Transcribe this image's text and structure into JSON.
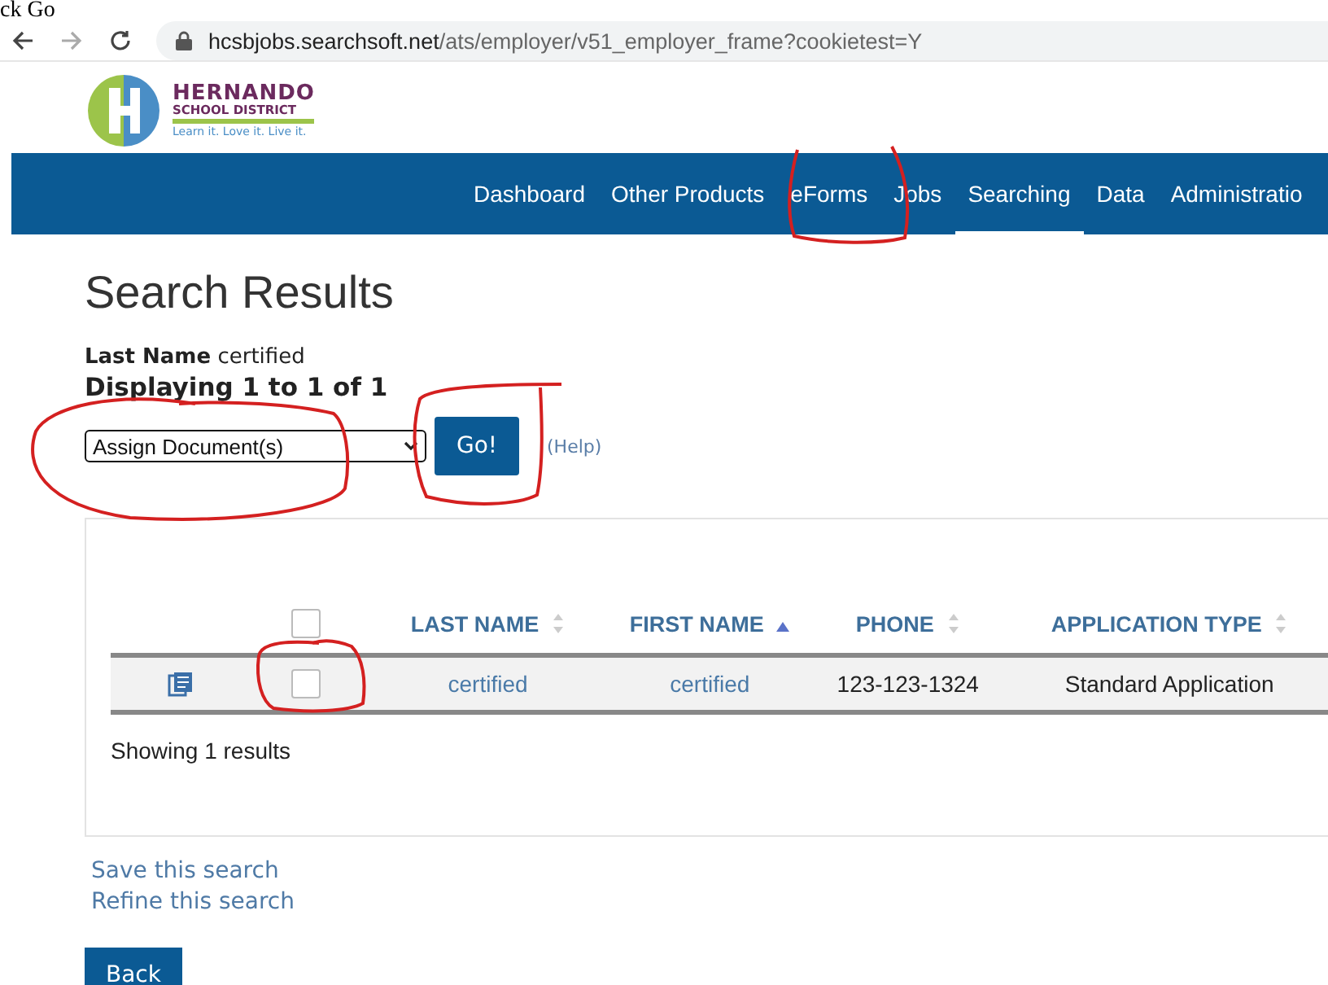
{
  "caption": "ck Go",
  "browser": {
    "url_host": "hcsbjobs.searchsoft.net",
    "url_path": "/ats/employer/v51_employer_frame?cookietest=Y"
  },
  "logo": {
    "name": "HERNANDO",
    "subtitle": "SCHOOL DISTRICT",
    "tagline": "Learn it. Love it. Live it."
  },
  "nav": [
    {
      "label": "Dashboard",
      "selected": false
    },
    {
      "label": "Other Products",
      "selected": false
    },
    {
      "label": "eForms",
      "selected": false
    },
    {
      "label": "Jobs",
      "selected": false
    },
    {
      "label": "Searching",
      "selected": true
    },
    {
      "label": "Data",
      "selected": false
    },
    {
      "label": "Administratio",
      "selected": false
    }
  ],
  "title": "Search Results",
  "criteria": {
    "label": "Last Name",
    "value": "certified"
  },
  "displaying": "Displaying 1 to 1 of 1",
  "action": {
    "value": "Assign Document(s)",
    "button": "Go!",
    "help": "(Help)"
  },
  "table": {
    "select_all_checked": false,
    "columns": [
      {
        "label": "LAST NAME",
        "sorted": false
      },
      {
        "label": "FIRST NAME",
        "sorted": true
      },
      {
        "label": "PHONE",
        "sorted": false
      },
      {
        "label": "APPLICATION TYPE",
        "sorted": false
      }
    ],
    "rows": [
      {
        "checked": false,
        "cells": [
          "certified",
          "certified",
          "123-123-1324",
          "Standard Application"
        ]
      }
    ],
    "footer": "Showing 1 results"
  },
  "links": [
    "Save this search",
    "Refine this search"
  ],
  "back_button": "Back"
}
